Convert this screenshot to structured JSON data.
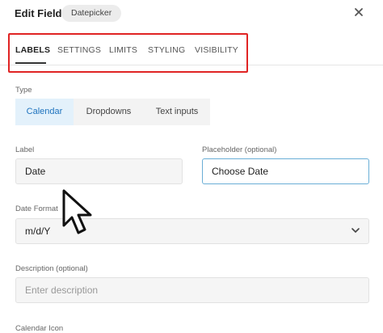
{
  "header": {
    "title": "Edit Field",
    "badge": "Datepicker",
    "close_icon": "close-icon"
  },
  "tabs": [
    {
      "label": "LABELS",
      "active": true
    },
    {
      "label": "SETTINGS",
      "active": false
    },
    {
      "label": "LIMITS",
      "active": false
    },
    {
      "label": "STYLING",
      "active": false
    },
    {
      "label": "VISIBILITY",
      "active": false
    }
  ],
  "type": {
    "label": "Type",
    "options": [
      "Calendar",
      "Dropdowns",
      "Text inputs"
    ],
    "selected": "Calendar"
  },
  "label_field": {
    "label": "Label",
    "value": "Date"
  },
  "placeholder_field": {
    "label": "Placeholder (optional)",
    "value": "Choose Date"
  },
  "date_format": {
    "label": "Date Format",
    "value": "m/d/Y"
  },
  "description": {
    "label": "Description (optional)",
    "placeholder": "Enter description"
  },
  "calendar_icon": {
    "label": "Calendar Icon"
  },
  "colors": {
    "highlight_border": "#e02424",
    "accent": "#1e73be",
    "focus_border": "#6aaed6"
  }
}
